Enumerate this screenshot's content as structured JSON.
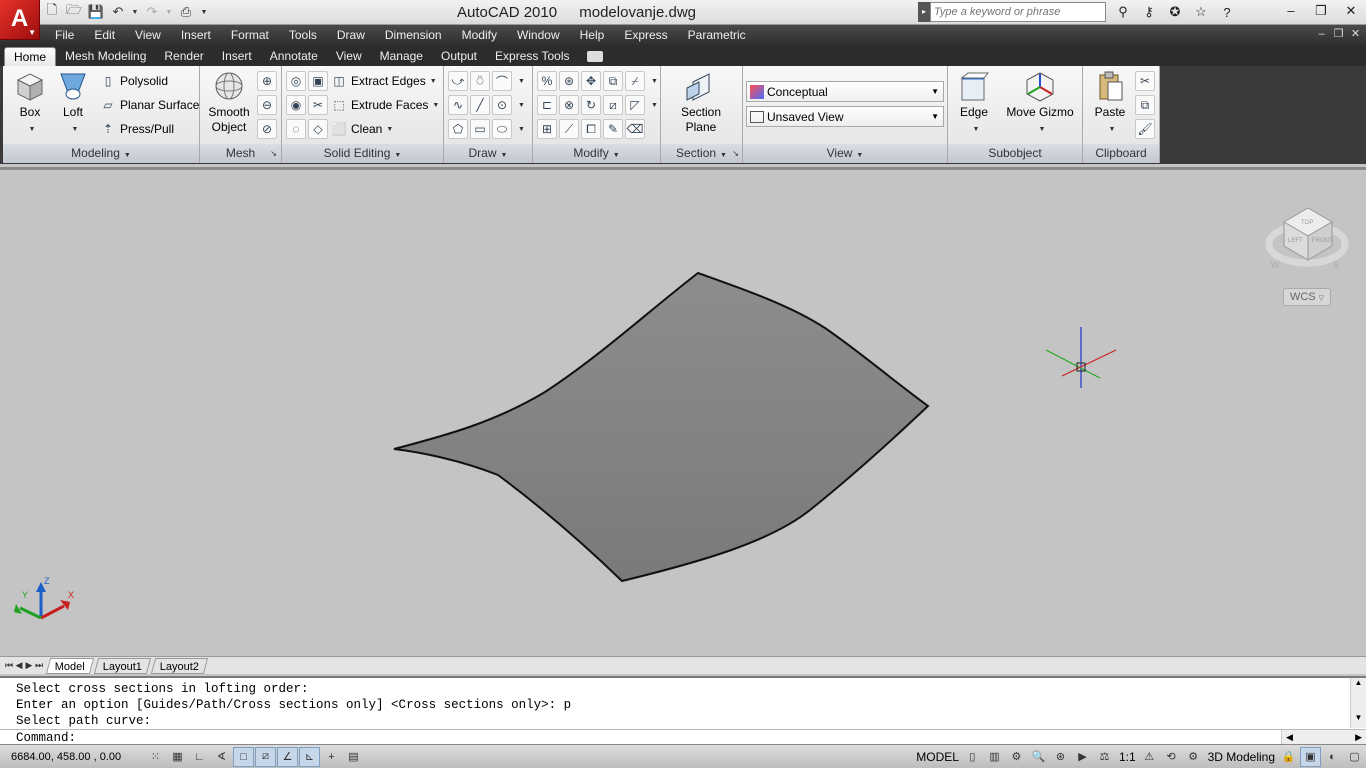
{
  "app": {
    "title": "AutoCAD 2010",
    "document": "modelovanje.dwg",
    "logo_letter": "A",
    "search_placeholder": "Type a keyword or phrase"
  },
  "menus": [
    "File",
    "Edit",
    "View",
    "Insert",
    "Format",
    "Tools",
    "Draw",
    "Dimension",
    "Modify",
    "Window",
    "Help",
    "Express",
    "Parametric"
  ],
  "ribbon_tabs": [
    "Home",
    "Mesh Modeling",
    "Render",
    "Insert",
    "Annotate",
    "View",
    "Manage",
    "Output",
    "Express Tools"
  ],
  "active_tab": "Home",
  "panels": {
    "modeling": {
      "title": "Modeling",
      "box": "Box",
      "loft": "Loft",
      "polysolid": "Polysolid",
      "planar_surface": "Planar Surface",
      "press_pull": "Press/Pull"
    },
    "mesh": {
      "title": "Mesh",
      "smooth_object_1": "Smooth",
      "smooth_object_2": "Object"
    },
    "solid_editing": {
      "title": "Solid Editing",
      "extract_edges": "Extract Edges",
      "extrude_faces": "Extrude Faces",
      "clean": "Clean"
    },
    "draw": {
      "title": "Draw"
    },
    "modify": {
      "title": "Modify"
    },
    "section": {
      "title": "Section",
      "section_plane_1": "Section",
      "section_plane_2": "Plane"
    },
    "view": {
      "title": "View",
      "visual_style": "Conceptual",
      "named_view": "Unsaved View"
    },
    "subobject": {
      "title": "Subobject",
      "edge": "Edge",
      "move_gizmo": "Move Gizmo"
    },
    "clipboard": {
      "title": "Clipboard",
      "paste": "Paste"
    }
  },
  "viewport": {
    "wcs_label": "WCS",
    "viewcube_top": "TOP",
    "viewcube_left": "LEFT",
    "viewcube_front": "FRONT",
    "compass_w": "W",
    "compass_s": "S",
    "ucs_x": "X",
    "ucs_y": "Y",
    "ucs_z": "Z"
  },
  "layout_tabs": [
    "Model",
    "Layout1",
    "Layout2"
  ],
  "command": {
    "history": [
      "Select cross sections in lofting order:",
      "Enter an option [Guides/Path/Cross sections only] <Cross sections only>: p",
      "Select path curve:"
    ],
    "prompt": "Command:"
  },
  "status": {
    "coords": "6684.00, 458.00 , 0.00",
    "model": "MODEL",
    "scale": "1:1",
    "workspace": "3D Modeling"
  },
  "colors": {
    "surface_fill": "#848484",
    "viewport_bg": "#c4c4c4",
    "ribbon_dark": "#2c2c2c",
    "crosshair_x": "#cc2222",
    "crosshair_y": "#22aa22",
    "crosshair_z": "#2233cc"
  }
}
